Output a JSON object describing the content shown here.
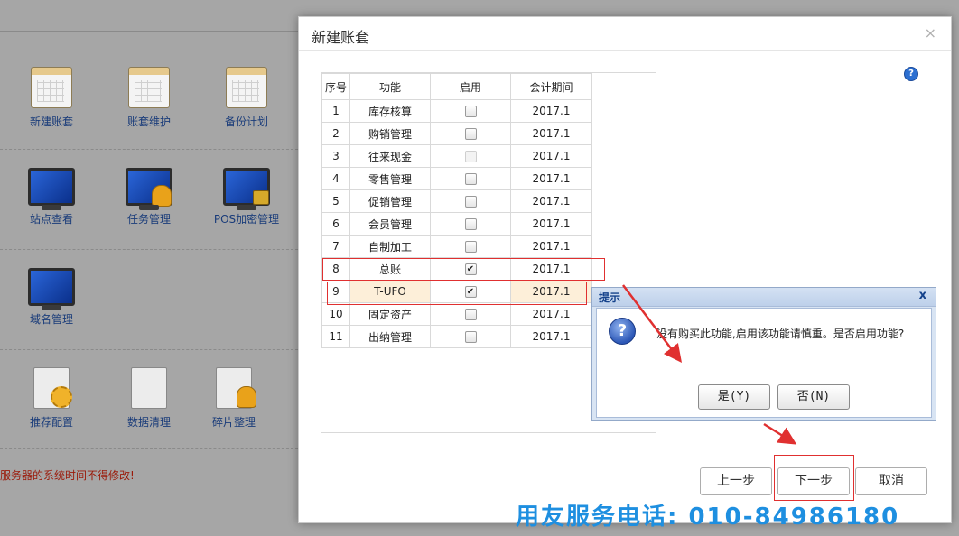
{
  "background": {
    "launchers": [
      {
        "label": "新建账套",
        "icon": "calendar-edit-icon"
      },
      {
        "label": "账套维护",
        "icon": "calendar-tools-icon"
      },
      {
        "label": "备份计划",
        "icon": "calendar-stack-icon"
      },
      {
        "label": "站点查看",
        "icon": "monitor-icon"
      },
      {
        "label": "任务管理",
        "icon": "monitor-user-icon"
      },
      {
        "label": "POS加密管理",
        "icon": "monitor-lock-icon"
      },
      {
        "label": "域名管理",
        "icon": "monitor-icon"
      },
      {
        "label": "推荐配置",
        "icon": "doc-gear-icon"
      },
      {
        "label": "数据清理",
        "icon": "doc-edit-icon"
      },
      {
        "label": "碎片整理",
        "icon": "doc-user-icon"
      }
    ],
    "warning": "服务器的系统时间不得修改!"
  },
  "dialog": {
    "title": "新建账套",
    "close": "×",
    "help": "?",
    "columns": [
      "序号",
      "功能",
      "启用",
      "会计期间"
    ],
    "rows": [
      {
        "no": "1",
        "name": "库存核算",
        "enabled": false,
        "disabled": false,
        "period": "2017.1"
      },
      {
        "no": "2",
        "name": "购销管理",
        "enabled": false,
        "disabled": false,
        "period": "2017.1"
      },
      {
        "no": "3",
        "name": "往来现金",
        "enabled": false,
        "disabled": true,
        "period": "2017.1"
      },
      {
        "no": "4",
        "name": "零售管理",
        "enabled": false,
        "disabled": false,
        "period": "2017.1"
      },
      {
        "no": "5",
        "name": "促销管理",
        "enabled": false,
        "disabled": false,
        "period": "2017.1"
      },
      {
        "no": "6",
        "name": "会员管理",
        "enabled": false,
        "disabled": false,
        "period": "2017.1"
      },
      {
        "no": "7",
        "name": "自制加工",
        "enabled": false,
        "disabled": false,
        "period": "2017.1"
      },
      {
        "no": "8",
        "name": "总账",
        "enabled": true,
        "disabled": false,
        "period": "2017.1"
      },
      {
        "no": "9",
        "name": "T-UFO",
        "enabled": true,
        "disabled": false,
        "period": "2017.1"
      },
      {
        "no": "10",
        "name": "固定资产",
        "enabled": false,
        "disabled": false,
        "period": "2017.1"
      },
      {
        "no": "11",
        "name": "出纳管理",
        "enabled": false,
        "disabled": false,
        "period": "2017.1"
      }
    ],
    "buttons": {
      "prev": "上一步",
      "next": "下一步",
      "cancel": "取消"
    }
  },
  "prompt": {
    "title": "提示",
    "close": "x",
    "icon": "?",
    "message": "没有购买此功能,启用该功能请慎重。是否启用功能?",
    "yes": "是(Y)",
    "no": "否(N)"
  },
  "service_hotline": "用友服务电话: 010-84986180",
  "colors": {
    "annotation": "#e03030",
    "hotline": "#1e8fe0",
    "highlight_row": "#fdefd9"
  }
}
